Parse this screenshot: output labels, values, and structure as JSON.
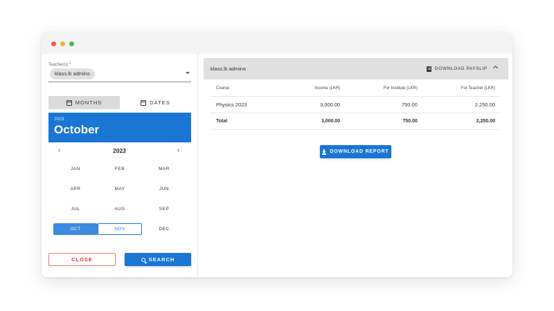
{
  "filters": {
    "teacher_label": "Teacher(s) *",
    "teacher_chip": "klass.lk admins"
  },
  "tabs": [
    {
      "label": "MONTHS",
      "active": true
    },
    {
      "label": "DATES",
      "active": false
    }
  ],
  "calendar": {
    "header_year": "2023",
    "header_month": "October",
    "nav_year": "2023",
    "prev_glyph": "‹",
    "next_glyph": "›",
    "months": [
      {
        "label": "JAN",
        "state": ""
      },
      {
        "label": "FEB",
        "state": ""
      },
      {
        "label": "MAR",
        "state": ""
      },
      {
        "label": "APR",
        "state": ""
      },
      {
        "label": "MAY",
        "state": ""
      },
      {
        "label": "JUN",
        "state": ""
      },
      {
        "label": "JUL",
        "state": ""
      },
      {
        "label": "AUG",
        "state": ""
      },
      {
        "label": "SEP",
        "state": ""
      },
      {
        "label": "OCT",
        "state": "selected"
      },
      {
        "label": "NOV",
        "state": "current"
      },
      {
        "label": "DEC",
        "state": ""
      }
    ]
  },
  "actions": {
    "close_label": "CLOSE",
    "search_label": "SEARCH"
  },
  "report": {
    "accordion_title": "klass.lk admins",
    "payslip_label": "DOWNLOAD PAYSLIP",
    "columns": [
      "Course",
      "Income (LKR)",
      "For Institute (LKR)",
      "For Teacher (LKR)"
    ],
    "rows": [
      [
        "Physics 2023",
        "3,000.00",
        "750.00",
        "2,250.00"
      ]
    ],
    "total": [
      "Total",
      "3,000.00",
      "750.00",
      "2,250.00"
    ],
    "download_report_label": "DOWNLOAD REPORT"
  },
  "colors": {
    "primary": "#1976d2",
    "selected_month": "#3d8bdf",
    "close_red": "#d32f2f"
  }
}
